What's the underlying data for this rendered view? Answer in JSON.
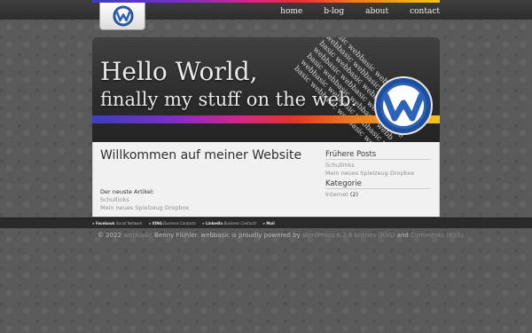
{
  "nav": {
    "items": [
      {
        "label": "home"
      },
      {
        "label": "b-log"
      },
      {
        "label": "about"
      },
      {
        "label": "contact"
      }
    ]
  },
  "banner": {
    "line1": "Hello World,",
    "line2": "finally my stuff on the web.",
    "watermark": [
      "basic webbasic webbasic web",
      "webbasic webbasic webbasic w",
      "basic webbasic webbasic webba",
      "webbasic webbasic webbasic we",
      "basic webbasic webbasic webb",
      "webbasic webbasic webbasic w",
      "basic webbasic webbasic web"
    ]
  },
  "main": {
    "title": "Willkommen auf meiner Website",
    "latest_label": "Der neuste Artikel:",
    "latest_links": [
      "Schullinks",
      "Mein neues Spielzeug Dropbox"
    ]
  },
  "sidebar": {
    "posts_heading": "Frühere Posts",
    "posts": [
      "Schullinks",
      "Mein neues Spielzeug Dropbox"
    ],
    "categories_heading": "Kategorie",
    "category_name": "Internet",
    "category_count": "(2)"
  },
  "linkbar": {
    "items": [
      {
        "name": "» Facebook",
        "desc": "Social Network"
      },
      {
        "name": "» XING",
        "desc": "Business Contacts"
      },
      {
        "name": "» LinkedIn",
        "desc": "Business Contacts"
      },
      {
        "name": "» Mail",
        "desc": ""
      }
    ]
  },
  "footer": {
    "copyright": "© 2022",
    "site": "webbasic",
    "author_text": "Benny Flühler. webbasic is proudly powered by",
    "wp": "WordPress 6.2.6",
    "entries": "Entries (RSS)",
    "and": "and",
    "comments": "Comments (RSS)"
  },
  "colors": {
    "accent_rainbow": [
      "#3b3ec0",
      "#7a2ec8",
      "#d3268a",
      "#e8322a",
      "#f07a1e",
      "#f4c21c"
    ],
    "logo_blue": "#2c63b8"
  },
  "icons": {
    "header_logo": "webbasic-w-logo-icon",
    "banner_logo": "webbasic-w-logo-icon"
  }
}
